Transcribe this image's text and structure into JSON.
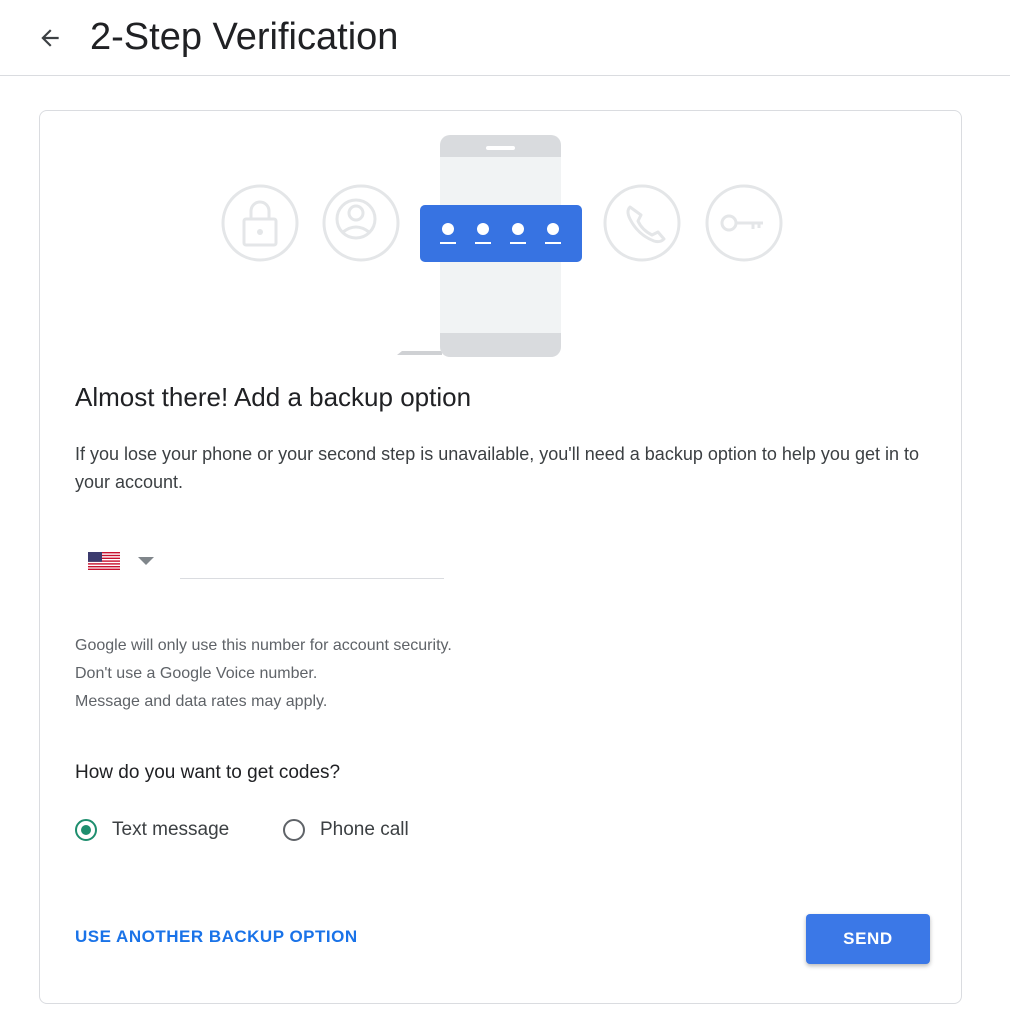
{
  "header": {
    "title": "2-Step Verification",
    "back_icon": "arrow-back-icon"
  },
  "hero": {
    "icons": [
      "lock-icon",
      "account-circle-icon",
      "phone-icon",
      "key-icon"
    ],
    "code_dots": 4,
    "accent_color": "#3b78e7"
  },
  "card": {
    "heading": "Almost there! Add a backup option",
    "description": "If you lose your phone or your second step is unavailable, you'll need a backup option to help you get in to your account.",
    "phone": {
      "country_flag": "us-flag-icon",
      "value": "",
      "placeholder": ""
    },
    "notes": [
      "Google will only use this number for account security.",
      "Don't use a Google Voice number.",
      "Message and data rates may apply."
    ],
    "codes_question": "How do you want to get codes?",
    "options": [
      {
        "label": "Text message",
        "selected": true
      },
      {
        "label": "Phone call",
        "selected": false
      }
    ],
    "another_option_label": "USE ANOTHER BACKUP OPTION",
    "send_label": "SEND"
  },
  "colors": {
    "primary": "#1a73e8",
    "radio_selected": "#1e8e6e"
  }
}
